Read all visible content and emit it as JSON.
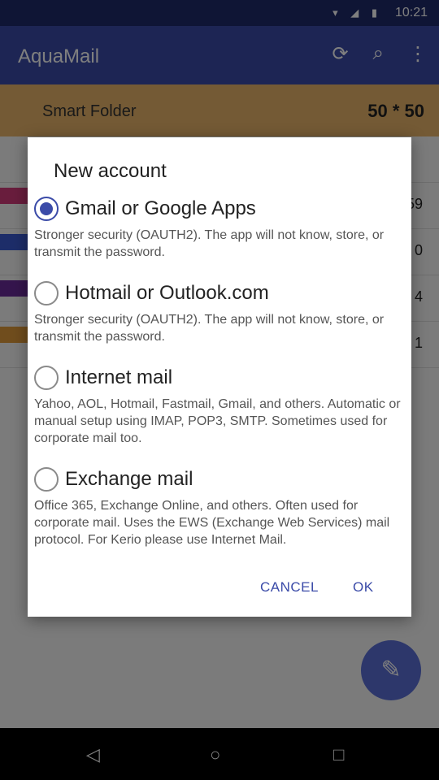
{
  "status_bar": {
    "time": "10:21"
  },
  "app_bar": {
    "title": "AquaMail"
  },
  "folder_bar": {
    "name": "Smart Folder",
    "count": "50 * 50"
  },
  "list": {
    "counts": [
      "",
      "59",
      "0",
      "4",
      "1"
    ]
  },
  "dialog": {
    "title": "New account",
    "options": [
      {
        "label": "Gmail or Google Apps",
        "description": "Stronger security (OAUTH2). The app will not know, store, or transmit the password.",
        "selected": true
      },
      {
        "label": "Hotmail or Outlook.com",
        "description": "Stronger security (OAUTH2). The app will not know, store, or transmit the password.",
        "selected": false
      },
      {
        "label": "Internet mail",
        "description": "Yahoo, AOL, Hotmail, Fastmail, Gmail, and others. Automatic or manual setup using IMAP, POP3, SMTP. Sometimes used for corporate mail too.",
        "selected": false
      },
      {
        "label": "Exchange mail",
        "description": "Office 365, Exchange Online, and others. Often used for corporate mail. Uses the EWS (Exchange Web Services) mail protocol. For Kerio please use Internet Mail.",
        "selected": false
      }
    ],
    "cancel_label": "CANCEL",
    "ok_label": "OK"
  },
  "colors": {
    "accent": "#3b4ba8",
    "folder_bar": "#e9b56b"
  }
}
